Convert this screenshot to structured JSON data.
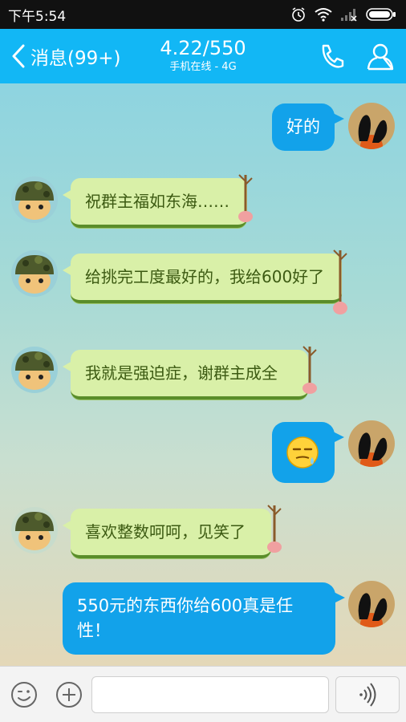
{
  "status_bar": {
    "time": "下午5:54"
  },
  "header": {
    "back_label": "消息(99+)",
    "title": "4.22/550",
    "subtitle": "手机在线 - 4G"
  },
  "messages": [
    {
      "side": "right",
      "sender": "self",
      "text": "好的"
    },
    {
      "side": "left",
      "sender": "other",
      "text": "祝群主福如东海……"
    },
    {
      "side": "left",
      "sender": "other",
      "text": "给挑完工度最好的，我给600好了"
    },
    {
      "side": "left",
      "sender": "other",
      "text": "我就是强迫症，谢群主成全"
    },
    {
      "side": "right",
      "sender": "self",
      "emoji": "sleepy-face-emoji"
    },
    {
      "side": "left",
      "sender": "other",
      "text": "喜欢整数呵呵，见笑了"
    },
    {
      "side": "right",
      "sender": "self",
      "text": "550元的东西你给600真是任性！"
    }
  ],
  "colors": {
    "header_bg": "#12b7f5",
    "self_bubble": "#12a2ea",
    "other_bubble": "#d9f0a8"
  },
  "input_bar": {
    "message_value": ""
  }
}
